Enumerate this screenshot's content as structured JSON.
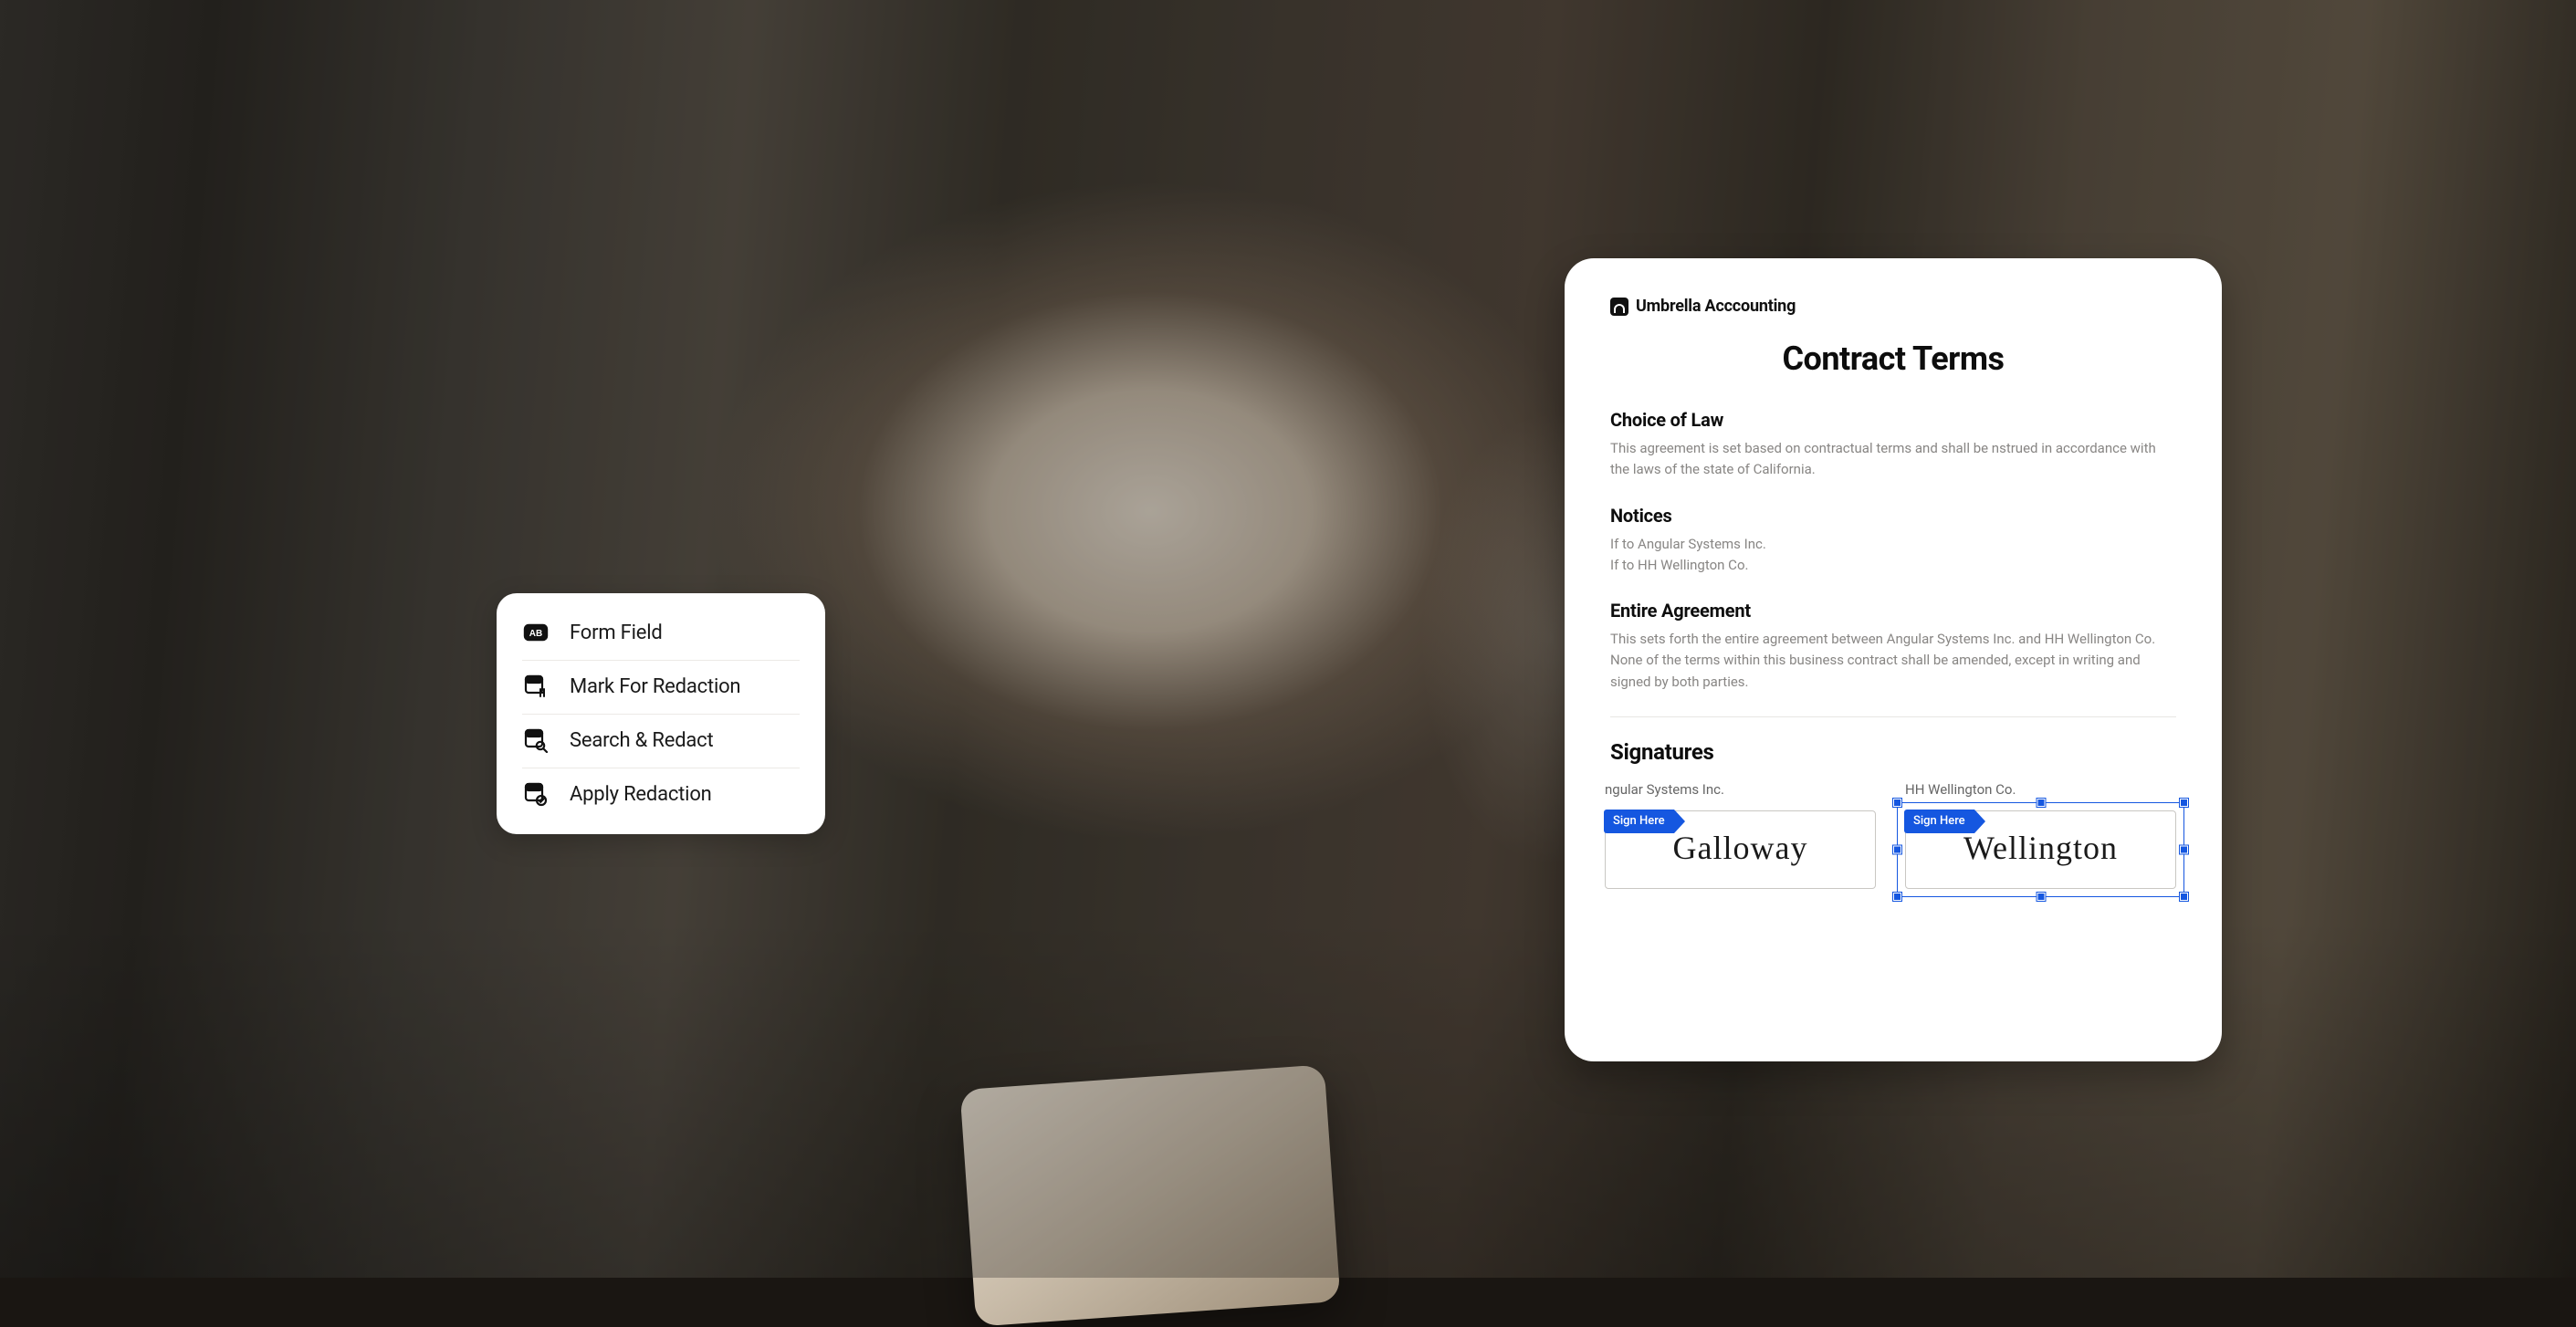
{
  "menu": {
    "items": [
      {
        "name": "form-field",
        "label": "Form Field"
      },
      {
        "name": "mark-for-redaction",
        "label": "Mark For Redaction"
      },
      {
        "name": "search-and-redact",
        "label": "Search & Redact"
      },
      {
        "name": "apply-redaction",
        "label": "Apply Redaction"
      }
    ]
  },
  "document": {
    "brand": "Umbrella Acccounting",
    "title": "Contract Terms",
    "sections": {
      "choice_of_law": {
        "heading": "Choice of Law",
        "body": "This agreement is set based on contractual terms and shall be nstrued in accordance with the laws of the state of California."
      },
      "notices": {
        "heading": "Notices",
        "line1": "If to Angular Systems Inc.",
        "line2": "If to HH Wellington Co."
      },
      "entire_agreement": {
        "heading": "Entire Agreement",
        "body": "This sets forth the entire agreement between Angular Systems Inc. and HH Wellington Co. None of the terms within this business contract shall be amended, except in writing and signed by both parties."
      }
    },
    "signatures": {
      "heading": "Signatures",
      "sign_here_label": "Sign Here",
      "parties": [
        {
          "name": "Angular Systems Inc.",
          "signature": "Galloway",
          "selected": false,
          "name_truncated": "ngular Systems Inc."
        },
        {
          "name": "HH Wellington Co.",
          "signature": "Wellington",
          "selected": true
        }
      ]
    }
  }
}
